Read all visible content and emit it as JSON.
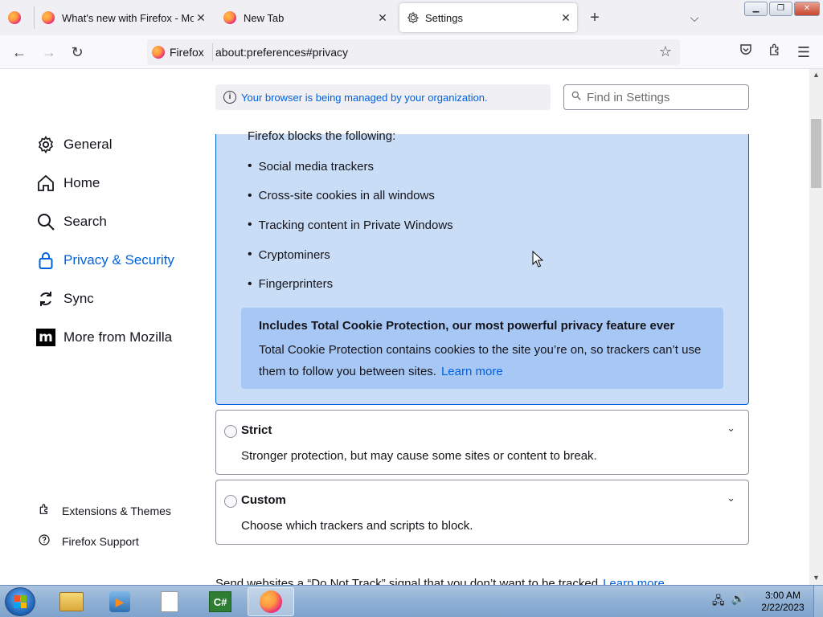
{
  "tabs": [
    {
      "title": "What's new with Firefox - More",
      "icon": "firefox-icon"
    },
    {
      "title": "New Tab",
      "icon": "firefox-icon"
    },
    {
      "title": "Settings",
      "icon": "gear-icon",
      "active": true
    }
  ],
  "toolbar": {
    "identity_label": "Firefox",
    "url": "about:preferences#privacy"
  },
  "policy_notice": "Your browser is being managed by your organization.",
  "find_placeholder": "Find in Settings",
  "sidebar": {
    "items": [
      {
        "label": "General",
        "icon": "gear-icon"
      },
      {
        "label": "Home",
        "icon": "home-icon"
      },
      {
        "label": "Search",
        "icon": "search-icon"
      },
      {
        "label": "Privacy & Security",
        "icon": "lock-icon",
        "selected": true
      },
      {
        "label": "Sync",
        "icon": "sync-icon"
      },
      {
        "label": "More from Mozilla",
        "icon": "mozilla-icon"
      }
    ],
    "footer": [
      {
        "label": "Extensions & Themes",
        "icon": "puzzle-icon"
      },
      {
        "label": "Firefox Support",
        "icon": "help-icon"
      }
    ]
  },
  "standard": {
    "heading": "Firefox blocks the following:",
    "blocked": [
      "Social media trackers",
      "Cross-site cookies in all windows",
      "Tracking content in Private Windows",
      "Cryptominers",
      "Fingerprinters"
    ],
    "tcp_title": "Includes Total Cookie Protection, our most powerful privacy feature ever",
    "tcp_body": "Total Cookie Protection contains cookies to the site you’re on, so trackers can’t use them to follow you between sites.",
    "tcp_link": "Learn more"
  },
  "options": {
    "strict": {
      "title": "Strict",
      "desc": "Stronger protection, but may cause some sites or content to break."
    },
    "custom": {
      "title": "Custom",
      "desc": "Choose which trackers and scripts to block."
    }
  },
  "dnt": {
    "text": "Send websites a “Do Not Track” signal that you don’t want to be tracked",
    "link": "Learn more"
  },
  "taskbar": {
    "time": "3:00 AM",
    "date": "2/22/2023",
    "cs_label": "C#"
  },
  "colors": {
    "accent": "#0061e0",
    "standard_bg": "#c9ddf7",
    "tcp_bg": "#a7c7f5"
  }
}
